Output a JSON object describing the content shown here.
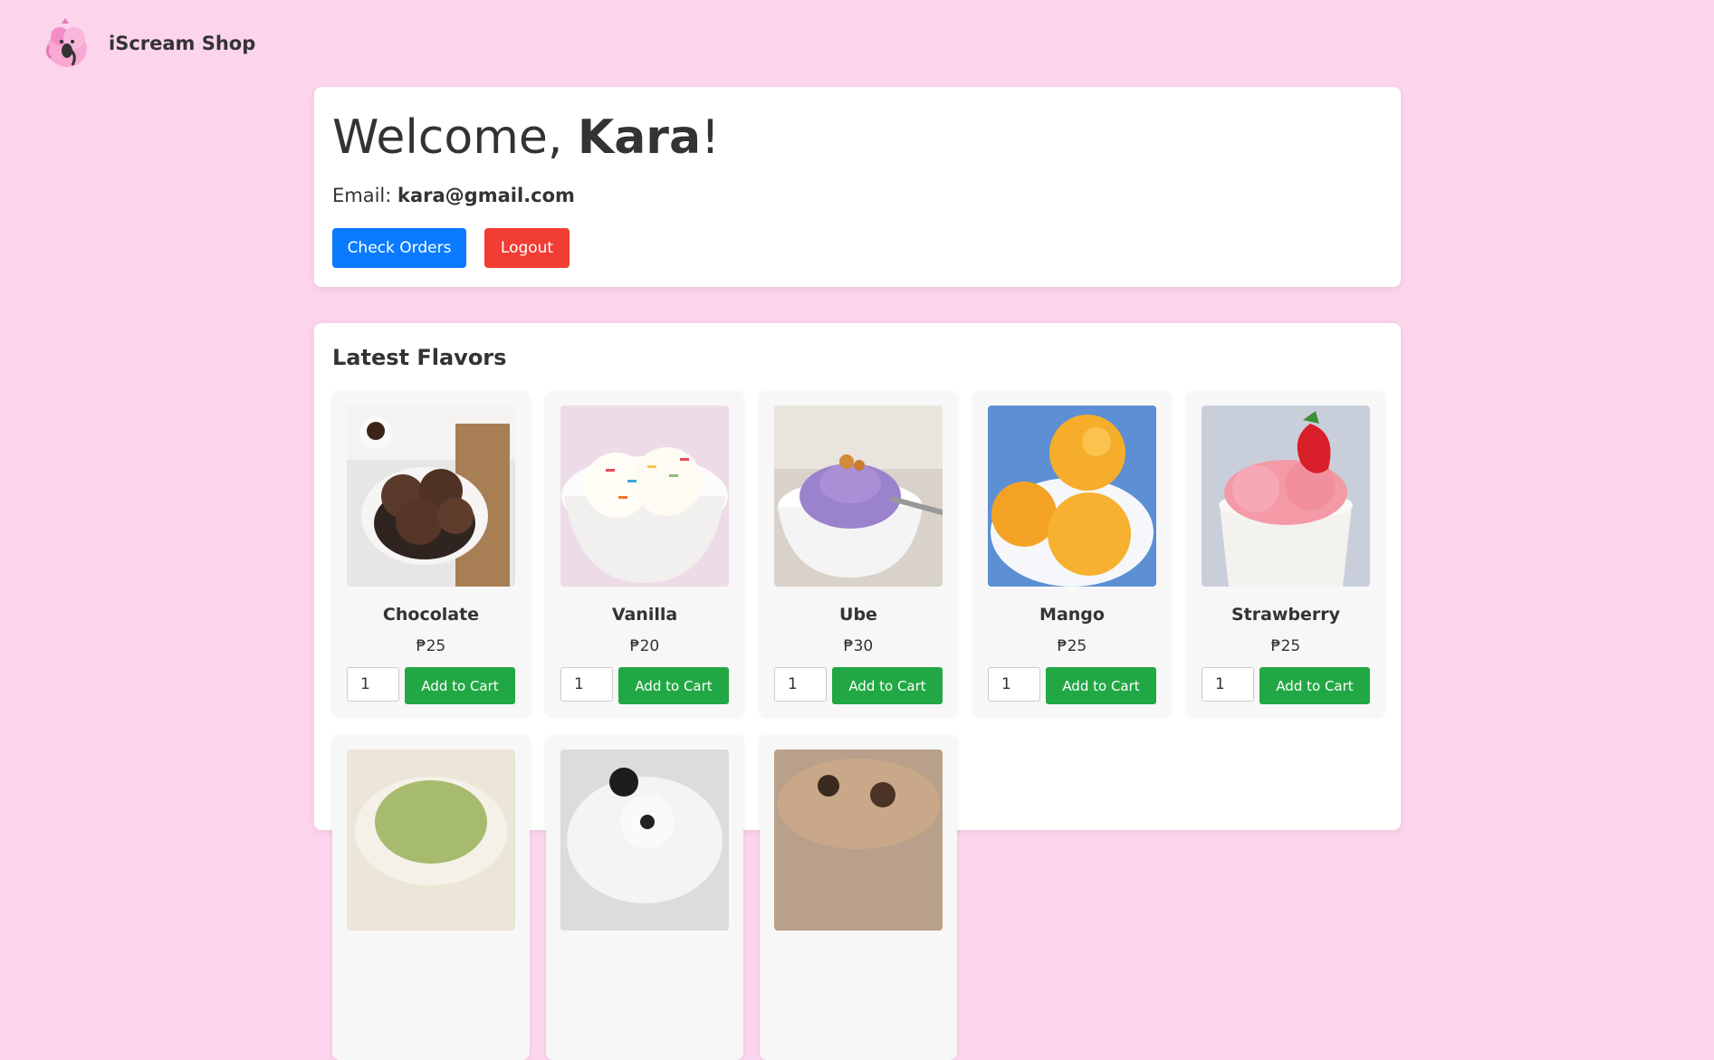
{
  "header": {
    "brand": "iScream Shop",
    "logo_icon": "elephant-ice-cream-logo-icon"
  },
  "welcome": {
    "greeting": "Welcome, ",
    "name": "Kara",
    "suffix": "!",
    "email_label": "Email: ",
    "email": "kara@gmail.com",
    "check_orders_label": "Check Orders",
    "logout_label": "Logout"
  },
  "flavors": {
    "title": "Latest Flavors",
    "items": [
      {
        "name": "Chocolate",
        "price": "₱25",
        "qty": "1",
        "cta": "Add to Cart"
      },
      {
        "name": "Vanilla",
        "price": "₱20",
        "qty": "1",
        "cta": "Add to Cart"
      },
      {
        "name": "Ube",
        "price": "₱30",
        "qty": "1",
        "cta": "Add to Cart"
      },
      {
        "name": "Mango",
        "price": "₱25",
        "qty": "1",
        "cta": "Add to Cart"
      },
      {
        "name": "Strawberry",
        "price": "₱25",
        "qty": "1",
        "cta": "Add to Cart"
      }
    ]
  },
  "colors": {
    "background": "#fcd4ec",
    "primary": "#0a7bff",
    "danger": "#f13d33",
    "success": "#22a745"
  }
}
